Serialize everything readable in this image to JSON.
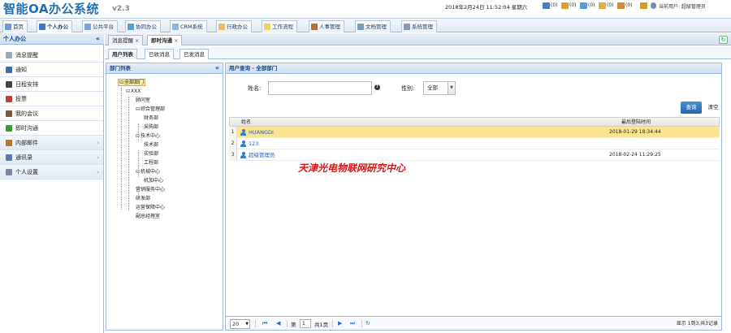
{
  "header": {
    "title": "智能OA办公系统",
    "version": "v2.3",
    "datetime": "2018年2月24日 11:52:04 星期六",
    "counters": [
      {
        "icon": "user-group-icon",
        "count": "(0)",
        "color": "#4a7cc0"
      },
      {
        "icon": "mail-icon",
        "count": "(0)",
        "color": "#d9a030"
      },
      {
        "icon": "message-icon",
        "count": "(0)",
        "color": "#5b9bd5"
      },
      {
        "icon": "note-icon",
        "count": "(0)",
        "color": "#e0b040"
      },
      {
        "icon": "chat-icon",
        "count": "(0)",
        "color": "#d08a3a"
      },
      {
        "icon": "lock-icon",
        "count": "",
        "color": "#c8a030"
      }
    ],
    "current_user": "当前用户: 超级管理员"
  },
  "nav": {
    "tabs": [
      {
        "label": "首页",
        "icon": "home-icon",
        "color": "#6a9bd8",
        "active": false
      },
      {
        "label": "个人办公",
        "icon": "person-icon",
        "color": "#3a78c8",
        "active": true
      },
      {
        "label": "公共平台",
        "icon": "platform-icon",
        "color": "#7aa6d6",
        "active": false
      },
      {
        "label": "协同办公",
        "icon": "collab-icon",
        "color": "#5ca0d0",
        "active": false
      },
      {
        "label": "CRM系统",
        "icon": "crm-icon",
        "color": "#8fb6e0",
        "active": false
      },
      {
        "label": "行政办公",
        "icon": "admin-icon",
        "color": "#e8c060",
        "active": false
      },
      {
        "label": "工作流程",
        "icon": "workflow-icon",
        "color": "#f0d060",
        "active": false
      },
      {
        "label": "人事管理",
        "icon": "hr-icon",
        "color": "#b0703a",
        "active": false
      },
      {
        "label": "文档管理",
        "icon": "document-icon",
        "color": "#7a9ac0",
        "active": false
      },
      {
        "label": "系统管理",
        "icon": "system-icon",
        "color": "#889aae",
        "active": false
      }
    ]
  },
  "sidebar": {
    "title": "个人办公",
    "items": [
      {
        "label": "消息提醒",
        "icon": "bell-icon",
        "color": "#9aa8b8",
        "group": false
      },
      {
        "label": "通知",
        "icon": "notice-icon",
        "color": "#3a6ea8",
        "group": false
      },
      {
        "label": "日程安排",
        "icon": "schedule-icon",
        "color": "#444",
        "group": false
      },
      {
        "label": "投票",
        "icon": "vote-icon",
        "color": "#c04040",
        "group": false
      },
      {
        "label": "我的会议",
        "icon": "meeting-icon",
        "color": "#7a5a3a",
        "group": false
      },
      {
        "label": "即时沟通",
        "icon": "chat-icon",
        "color": "#3a9a3a",
        "group": false
      },
      {
        "label": "内部邮件",
        "icon": "internal-mail-icon",
        "color": "#b07830",
        "group": true
      },
      {
        "label": "通讯录",
        "icon": "contacts-icon",
        "color": "#5a7ab0",
        "group": true
      },
      {
        "label": "个人设置",
        "icon": "settings-icon",
        "color": "#7a8a9a",
        "group": true
      }
    ]
  },
  "content_tabs": [
    {
      "label": "消息提醒",
      "active": false
    },
    {
      "label": "即时沟通",
      "active": true
    }
  ],
  "sub_tabs": [
    {
      "label": "用户列表",
      "active": true
    },
    {
      "label": "已收消息",
      "active": false
    },
    {
      "label": "已发消息",
      "active": false
    }
  ],
  "dept_panel": {
    "title": "部门列表",
    "nodes": [
      {
        "label": "全部部门",
        "level": 0,
        "selected": true,
        "expand": "⊟"
      },
      {
        "label": "XXX",
        "level": 1,
        "selected": false,
        "expand": "⊟"
      },
      {
        "label": "顾问室",
        "level": 2,
        "selected": false,
        "expand": ""
      },
      {
        "label": "综合管理部",
        "level": 2,
        "selected": false,
        "expand": "⊟"
      },
      {
        "label": "财务部",
        "level": 3,
        "selected": false,
        "expand": ""
      },
      {
        "label": "采购部",
        "level": 3,
        "selected": false,
        "expand": ""
      },
      {
        "label": "技术中心",
        "level": 2,
        "selected": false,
        "expand": "⊟"
      },
      {
        "label": "技术部",
        "level": 3,
        "selected": false,
        "expand": ""
      },
      {
        "label": "实验部",
        "level": 3,
        "selected": false,
        "expand": ""
      },
      {
        "label": "工程部",
        "level": 3,
        "selected": false,
        "expand": ""
      },
      {
        "label": "机械中心",
        "level": 2,
        "selected": false,
        "expand": "⊟"
      },
      {
        "label": "机加中心",
        "level": 3,
        "selected": false,
        "expand": ""
      },
      {
        "label": "营销服务中心",
        "level": 2,
        "selected": false,
        "expand": ""
      },
      {
        "label": "研发部",
        "level": 2,
        "selected": false,
        "expand": ""
      },
      {
        "label": "运营保障中心",
        "level": 2,
        "selected": false,
        "expand": ""
      },
      {
        "label": "副总经理室",
        "level": 2,
        "selected": false,
        "expand": ""
      }
    ]
  },
  "query": {
    "title": "用户查询 - 全部部门",
    "name_label": "姓名:",
    "name_value": "",
    "help": "?",
    "gender_label": "性别:",
    "gender_value": "全部",
    "search_label": "查询",
    "clear_label": "清空"
  },
  "grid": {
    "columns": [
      "姓名",
      "最后登陆时间"
    ],
    "rows": [
      {
        "n": "1",
        "name": "HUANGDI",
        "last_login": "2018-01-29 18:34:44",
        "highlight": true
      },
      {
        "n": "2",
        "name": "123",
        "last_login": "",
        "highlight": false
      },
      {
        "n": "3",
        "name": "超级管理员",
        "last_login": "2018-02-24 11:29:25",
        "highlight": false
      }
    ]
  },
  "watermark": "天津光电物联网研究中心",
  "pager": {
    "page_size": "20",
    "page_prefix": "第",
    "page_value": "1",
    "page_suffix": "共1页",
    "info": "显示 1到3,共3记录"
  }
}
